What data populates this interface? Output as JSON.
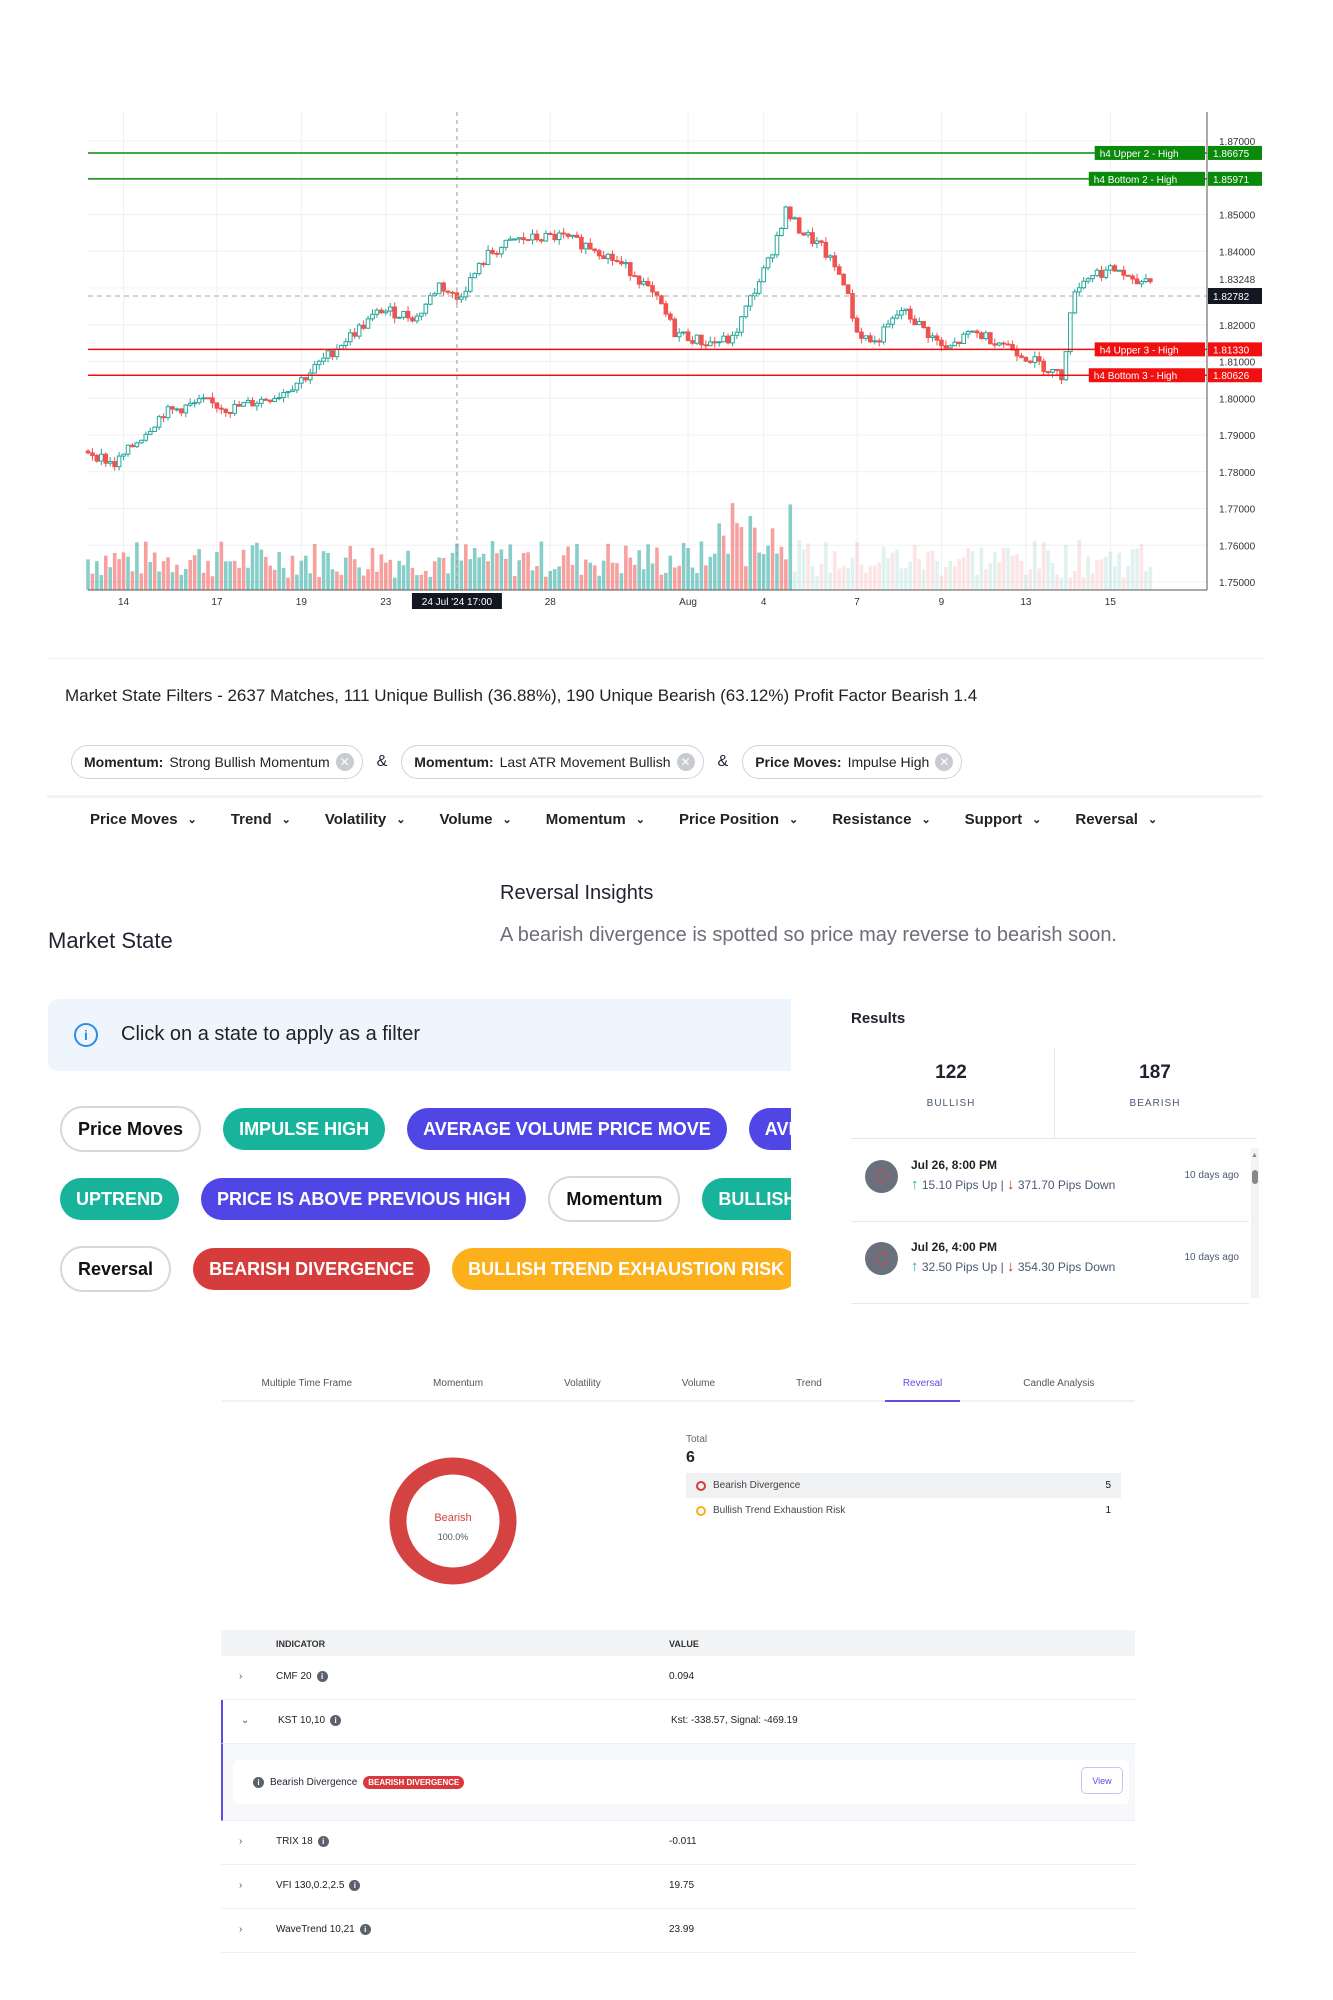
{
  "chart_data": {
    "type": "candlestick",
    "y_ticks": [
      "1.87000",
      "1.85000",
      "1.84000",
      "1.83248",
      "1.82000",
      "1.81000",
      "1.80000",
      "1.79000",
      "1.78000",
      "1.77000",
      "1.76000",
      "1.75000"
    ],
    "ylim": [
      1.75,
      1.87
    ],
    "x_ticks": [
      {
        "label": "14",
        "bar": 8
      },
      {
        "label": "17",
        "bar": 29
      },
      {
        "label": "19",
        "bar": 48
      },
      {
        "label": "23",
        "bar": 67
      },
      {
        "label": "28",
        "bar": 104
      },
      {
        "label": "Aug",
        "bar": 135
      },
      {
        "label": "4",
        "bar": 152
      },
      {
        "label": "7",
        "bar": 173
      },
      {
        "label": "9",
        "bar": 192
      },
      {
        "label": "13",
        "bar": 211
      },
      {
        "label": "15",
        "bar": 230
      }
    ],
    "crosshair": {
      "label": "24 Jul '24   17:00",
      "bar": 83
    },
    "current_price": {
      "label": "1.82782",
      "value": 1.82782
    },
    "levels": [
      {
        "name": "h4 Upper 2 - High",
        "value_label": "1.86675",
        "value": 1.86675,
        "color": "#0a8a0a"
      },
      {
        "name": "h4 Bottom 2 - High",
        "value_label": "1.85971",
        "value": 1.85971,
        "color": "#0a8a0a"
      },
      {
        "name": "h4 Upper 3 - High",
        "value_label": "1.81330",
        "value": 1.8133,
        "color": "#f01010"
      },
      {
        "name": "h4 Bottom 3 - High",
        "value_label": "1.80626",
        "value": 1.80626,
        "color": "#f01010"
      }
    ],
    "close_path": [
      [
        0,
        1.7856
      ],
      [
        6,
        1.782
      ],
      [
        10,
        1.787
      ],
      [
        17,
        1.796
      ],
      [
        26,
        1.799
      ],
      [
        32,
        1.797
      ],
      [
        43,
        1.801
      ],
      [
        49,
        1.806
      ],
      [
        57,
        1.815
      ],
      [
        66,
        1.824
      ],
      [
        74,
        1.822
      ],
      [
        79,
        1.831
      ],
      [
        83,
        1.827
      ],
      [
        90,
        1.839
      ],
      [
        96,
        1.843
      ],
      [
        106,
        1.844
      ],
      [
        114,
        1.841
      ],
      [
        123,
        1.834
      ],
      [
        129,
        1.825
      ],
      [
        132,
        1.818
      ],
      [
        139,
        1.815
      ],
      [
        145,
        1.816
      ],
      [
        149,
        1.827
      ],
      [
        153,
        1.837
      ],
      [
        157,
        1.851
      ],
      [
        160,
        1.846
      ],
      [
        165,
        1.841
      ],
      [
        170,
        1.832
      ],
      [
        173,
        1.818
      ],
      [
        177,
        1.815
      ],
      [
        183,
        1.824
      ],
      [
        187,
        1.82
      ],
      [
        193,
        1.813
      ],
      [
        199,
        1.818
      ],
      [
        206,
        1.815
      ],
      [
        213,
        1.81
      ],
      [
        219,
        1.806
      ],
      [
        222,
        1.83
      ],
      [
        226,
        1.834
      ],
      [
        232,
        1.835
      ],
      [
        235,
        1.831
      ],
      [
        239,
        1.833
      ]
    ],
    "bull_color": "#26a69a",
    "bear_color": "#ef5350"
  },
  "filters": {
    "title": "Market State Filters - 2637 Matches, 111 Unique Bullish (36.88%), 190 Unique Bearish (63.12%) Profit Factor Bearish 1.4",
    "joiner": "&",
    "active": [
      {
        "key": "Momentum:",
        "value": "Strong Bullish Momentum"
      },
      {
        "key": "Momentum:",
        "value": "Last ATR Movement Bullish"
      },
      {
        "key": "Price Moves:",
        "value": "Impulse High"
      }
    ],
    "dropdowns": [
      "Price Moves",
      "Trend",
      "Volatility",
      "Volume",
      "Momentum",
      "Price Position",
      "Resistance",
      "Support",
      "Reversal"
    ]
  },
  "market_state": {
    "title": "Market State",
    "info": "Click on a state to apply as a filter",
    "rows": [
      [
        {
          "label": "Price Moves",
          "kind": "category"
        },
        {
          "label": "IMPULSE HIGH",
          "color": "#17b39b"
        },
        {
          "label": "AVERAGE VOLUME PRICE MOVE",
          "color": "#4f46e5"
        },
        {
          "label": "AVE",
          "color": "#4f46e5"
        }
      ],
      [
        {
          "label": "UPTREND",
          "color": "#17b39b"
        },
        {
          "label": "PRICE IS ABOVE PREVIOUS HIGH",
          "color": "#4f46e5"
        },
        {
          "label": "Momentum",
          "kind": "category"
        },
        {
          "label": "BULLISH",
          "color": "#17b39b"
        }
      ],
      [
        {
          "label": "Reversal",
          "kind": "category"
        },
        {
          "label": "BEARISH DIVERGENCE",
          "color": "#d63c3c"
        },
        {
          "label": "BULLISH TREND EXHAUSTION RISK",
          "color": "#fbb01c"
        }
      ]
    ]
  },
  "insights": {
    "title": "Reversal Insights",
    "text": "A bearish divergence is spotted so price may reverse to bearish soon."
  },
  "results": {
    "title": "Results",
    "bullish_count": "122",
    "bullish_label": "BULLISH",
    "bearish_count": "187",
    "bearish_label": "BEARISH",
    "items": [
      {
        "date": "Jul 26, 8:00 PM",
        "up": "15.10 Pips Up",
        "down": "371.70 Pips Down",
        "ago": "10 days ago"
      },
      {
        "date": "Jul 26, 4:00 PM",
        "up": "32.50 Pips Up",
        "down": "354.30 Pips Down",
        "ago": "10 days ago"
      }
    ]
  },
  "tabs": [
    "Multiple Time Frame",
    "Momentum",
    "Volatility",
    "Volume",
    "Trend",
    "Reversal",
    "Candle Analysis"
  ],
  "active_tab": "Reversal",
  "reversal": {
    "donut_label": "Bearish",
    "donut_pct": "100.0%",
    "donut_fraction": 1.0,
    "donut_color": "#d44242",
    "total_label": "Total",
    "total": "6",
    "items": [
      {
        "label": "Bearish Divergence",
        "count": "5",
        "color": "#d63c3c"
      },
      {
        "label": "Bullish Trend Exhaustion Risk",
        "count": "1",
        "color": "#fbb01c"
      }
    ]
  },
  "table": {
    "col_indicator": "INDICATOR",
    "col_value": "VALUE",
    "rows": [
      {
        "name": "CMF 20",
        "value": "0.094"
      },
      {
        "name": "KST 10,10",
        "value": "Kst: -338.57, Signal: -469.19"
      },
      {
        "name": "TRIX 18",
        "value": "-0.011"
      },
      {
        "name": "VFI 130,0.2,2.5",
        "value": "19.75"
      },
      {
        "name": "WaveTrend 10,21",
        "value": "23.99"
      }
    ],
    "expanded": {
      "label": "Bearish Divergence",
      "badge": "BEARISH DIVERGENCE",
      "button": "View"
    }
  }
}
